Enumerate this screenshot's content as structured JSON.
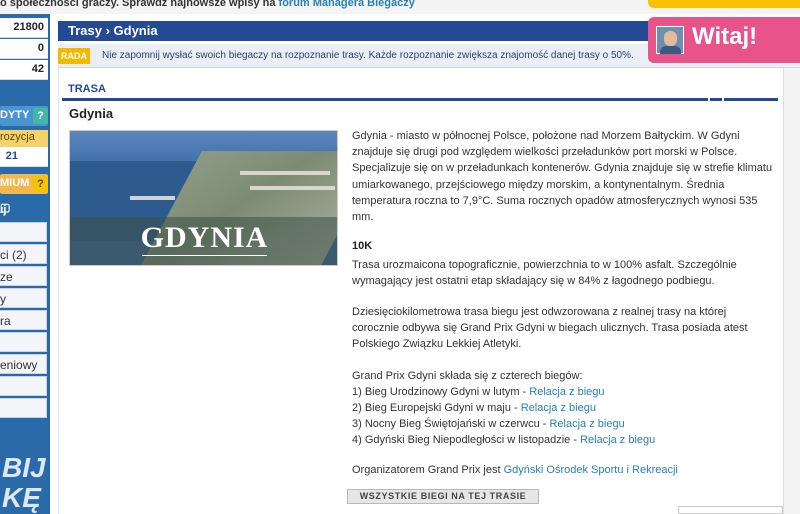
{
  "topbar": {
    "text": "o społeczności graczy. Sprawdź najnowsze wpisy na",
    "link": "forum Managera Biegaczy"
  },
  "sidebar": {
    "stats": [
      "21800",
      "0",
      "42"
    ],
    "buy_label": "DYTY",
    "buy_q": "?",
    "position_label": "rozycja",
    "position_value": "21",
    "premium_label": "MIUM",
    "premium_q": "?",
    "logout": "wyloguj",
    "items": [
      "ci (2)",
      "ze",
      "y",
      "ra",
      "",
      "eniowy",
      "",
      "",
      ""
    ],
    "promo_lines": [
      "BIJ",
      "KĘ"
    ]
  },
  "header": {
    "breadcrumb": "Trasy › Gdynia"
  },
  "rada": {
    "tag": "RADA",
    "message": "Nie zapomnij wysłać swoich biegaczy na rozpoznanie trasy. Każde rozpoznanie zwiększa znajomość danej trasy o 50%."
  },
  "user": {
    "greeting": "Witaj!"
  },
  "section": {
    "title": "TRASA"
  },
  "city": {
    "name": "Gdynia",
    "image_caption": "GDYNIA",
    "description": "Gdynia - miasto w północnej Polsce, położone nad Morzem Bałtyckim. W Gdyni znajduje się drugi pod względem wielkości przeładunków port morski w Polsce. Specjalizuje się on w przeładunkach kontenerów. Gdynia znajduje się w strefie klimatu umiarkowanego, przejściowego między morskim, a kontynentalnym. Średnia temperatura roczna to 7,9°C. Suma rocznych opadów atmosferycznych wynosi 535 mm."
  },
  "route": {
    "distance": "10K",
    "terrain": "Trasa urozmaicona topograficznie, powierzchnia to w 100% asfalt. Szczególnie wymagający jest ostatni etap składający się w 84% z łagodnego podbiegu.",
    "history": "Dziesięciokilometrowa trasa biegu jest odwzorowana z realnej trasy na której corocznie odbywa się Grand Prix Gdyni w biegach ulicznych. Trasa posiada atest Polskiego Związku Lekkiej Atletyki.",
    "intro": "Grand Prix Gdyni składa się z czterech biegów:",
    "runs": [
      {
        "text": "1) Bieg Urodzinowy Gdyni w lutym - ",
        "link": "Relacja z biegu"
      },
      {
        "text": "2) Bieg Europejski Gdyni w maju - ",
        "link": "Relacja z biegu"
      },
      {
        "text": "3) Nocny Bieg Świętojański w czerwcu - ",
        "link": "Relacja z biegu"
      },
      {
        "text": "4) Gdyński Bieg Niepodległości w listopadzie - ",
        "link": "Relacja z biegu"
      }
    ],
    "organizer_text": "Organizatorem Grand Prix jest ",
    "organizer_link": "Gdyński Ośrodek Sportu i Rekreacji",
    "all_runs_button": "WSZYSTKIE BIEGI NA TEJ TRASIE"
  }
}
